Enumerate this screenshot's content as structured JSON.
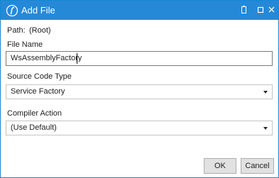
{
  "window": {
    "title": "Add File",
    "app_icon": "dark-studio-icon",
    "controls": [
      "restore-icon",
      "maximize-icon",
      "close-icon"
    ],
    "accent_color": "#2589d8"
  },
  "form": {
    "path_label": "Path:",
    "path_value": "(Root)",
    "filename_label": "File Name",
    "filename_value": "WsAssemblyFactory",
    "source_code_type_label": "Source Code Type",
    "source_code_type_value": "Service Factory",
    "compiler_action_label": "Compiler Action",
    "compiler_action_value": "(Use Default)"
  },
  "buttons": {
    "ok_label": "OK",
    "cancel_label": "Cancel"
  }
}
